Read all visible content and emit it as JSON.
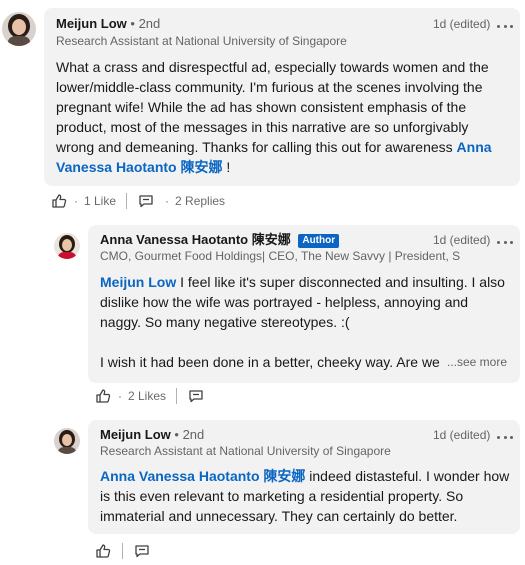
{
  "comments": [
    {
      "author": "Meijun Low",
      "degree": "• 2nd",
      "headline": "Research Assistant at National University of Singapore",
      "time": "1d (edited)",
      "text_pre": "What a crass and disrespectful ad, especially towards women and the lower/middle-class community. I'm furious at the scenes involving the pregnant wife! While the ad has shown consistent emphasis of the product, most of the messages in this narrative are so unforgivably wrong and demeaning. Thanks for calling this out for awareness ",
      "mention": "Anna Vanessa Haotanto 陳安娜",
      "text_post": " !",
      "likes": "1 Like",
      "replies": "2 Replies"
    },
    {
      "author": "Anna Vanessa Haotanto 陳安娜",
      "badge": "Author",
      "headline": "CMO, Gourmet Food Holdings| CEO, The New Savvy | President, S...",
      "time": "1d (edited)",
      "mention": "Meijun Low",
      "text_post": " I feel like it's super disconnected and insulting. I also dislike how the wife was portrayed - helpless, annoying and naggy. So many negative stereotypes. :(",
      "text_second": "I wish it had been done in a better, cheeky way. Are we",
      "see_more": "...see more",
      "likes": "2 Likes"
    },
    {
      "author": "Meijun Low",
      "degree": "• 2nd",
      "headline": "Research Assistant at National University of Singapore",
      "time": "1d (edited)",
      "mention": "Anna Vanessa Haotanto 陳安娜",
      "text_post": " indeed distasteful.  I wonder how is this even relevant to marketing a residential property. So immaterial and unnecessary. They can certainly do better."
    }
  ],
  "icons": {
    "like": "like-icon",
    "reply": "reply-icon",
    "more": "more-options-icon"
  },
  "colors": {
    "accent": "#0a66c2",
    "bubble": "#f2f2f2"
  }
}
